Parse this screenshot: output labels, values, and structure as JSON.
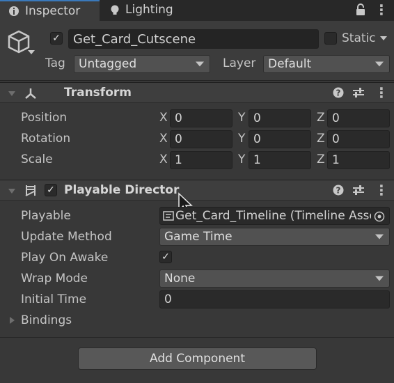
{
  "tabs": [
    {
      "label": "Inspector",
      "icon": "inspector-icon",
      "active": true
    },
    {
      "label": "Lighting",
      "icon": "lightbulb-icon",
      "active": false
    }
  ],
  "gameobject": {
    "active": true,
    "name": "Get_Card_Cutscene",
    "static_label": "Static",
    "tag_label": "Tag",
    "tag_value": "Untagged",
    "layer_label": "Layer",
    "layer_value": "Default"
  },
  "transform": {
    "title": "Transform",
    "rows": [
      {
        "label": "Position",
        "x": "0",
        "y": "0",
        "z": "0"
      },
      {
        "label": "Rotation",
        "x": "0",
        "y": "0",
        "z": "0"
      },
      {
        "label": "Scale",
        "x": "1",
        "y": "1",
        "z": "1"
      }
    ],
    "axis_labels": [
      "X",
      "Y",
      "Z"
    ]
  },
  "playable_director": {
    "title": "Playable Director",
    "enabled": true,
    "playable_label": "Playable",
    "playable_value": "Get_Card_Timeline (Timeline Asset)",
    "update_method_label": "Update Method",
    "update_method_value": "Game Time",
    "play_on_awake_label": "Play On Awake",
    "play_on_awake": true,
    "wrap_mode_label": "Wrap Mode",
    "wrap_mode_value": "None",
    "initial_time_label": "Initial Time",
    "initial_time_value": "0",
    "bindings_label": "Bindings"
  },
  "add_component_label": "Add Component",
  "colors": {
    "background": "#383838",
    "tab_accent": "#3a79bb",
    "field": "#2a2a2a",
    "dropdown": "#515151"
  }
}
